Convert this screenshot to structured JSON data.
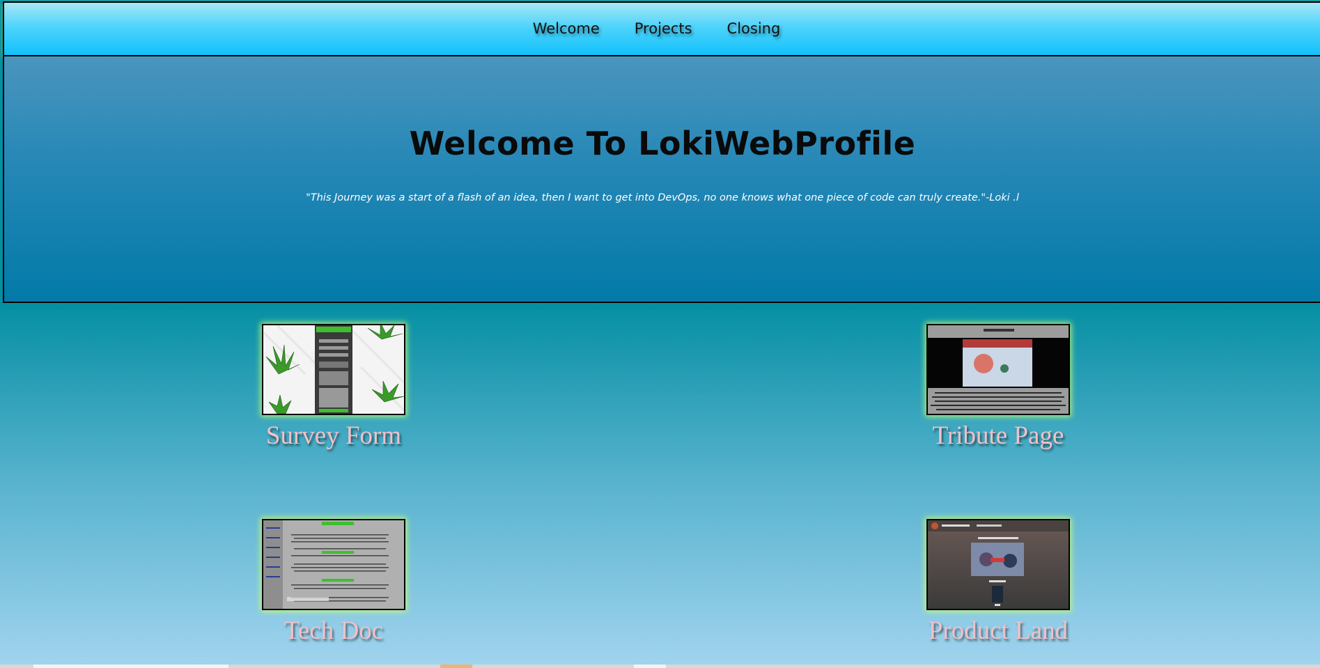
{
  "nav": {
    "links": [
      {
        "label": "Welcome"
      },
      {
        "label": "Projects"
      },
      {
        "label": "Closing"
      }
    ]
  },
  "hero": {
    "title": "Welcome To LokiWebProfile",
    "quote": "\"This Journey was a start of a flash of an idea, then I want to get into DevOps, no one knows what one piece of code can truly create.\"-Loki .l"
  },
  "projects": [
    {
      "title": "Survey Form"
    },
    {
      "title": "Tribute Page"
    },
    {
      "title": "Tech Doc"
    },
    {
      "title": "Product Land"
    }
  ],
  "colors": {
    "nav_bg": "#12c1fb",
    "hero_bg": "#027aa8",
    "caption": "#f1c1c9",
    "thumb_glow": "#c8ff6e"
  }
}
